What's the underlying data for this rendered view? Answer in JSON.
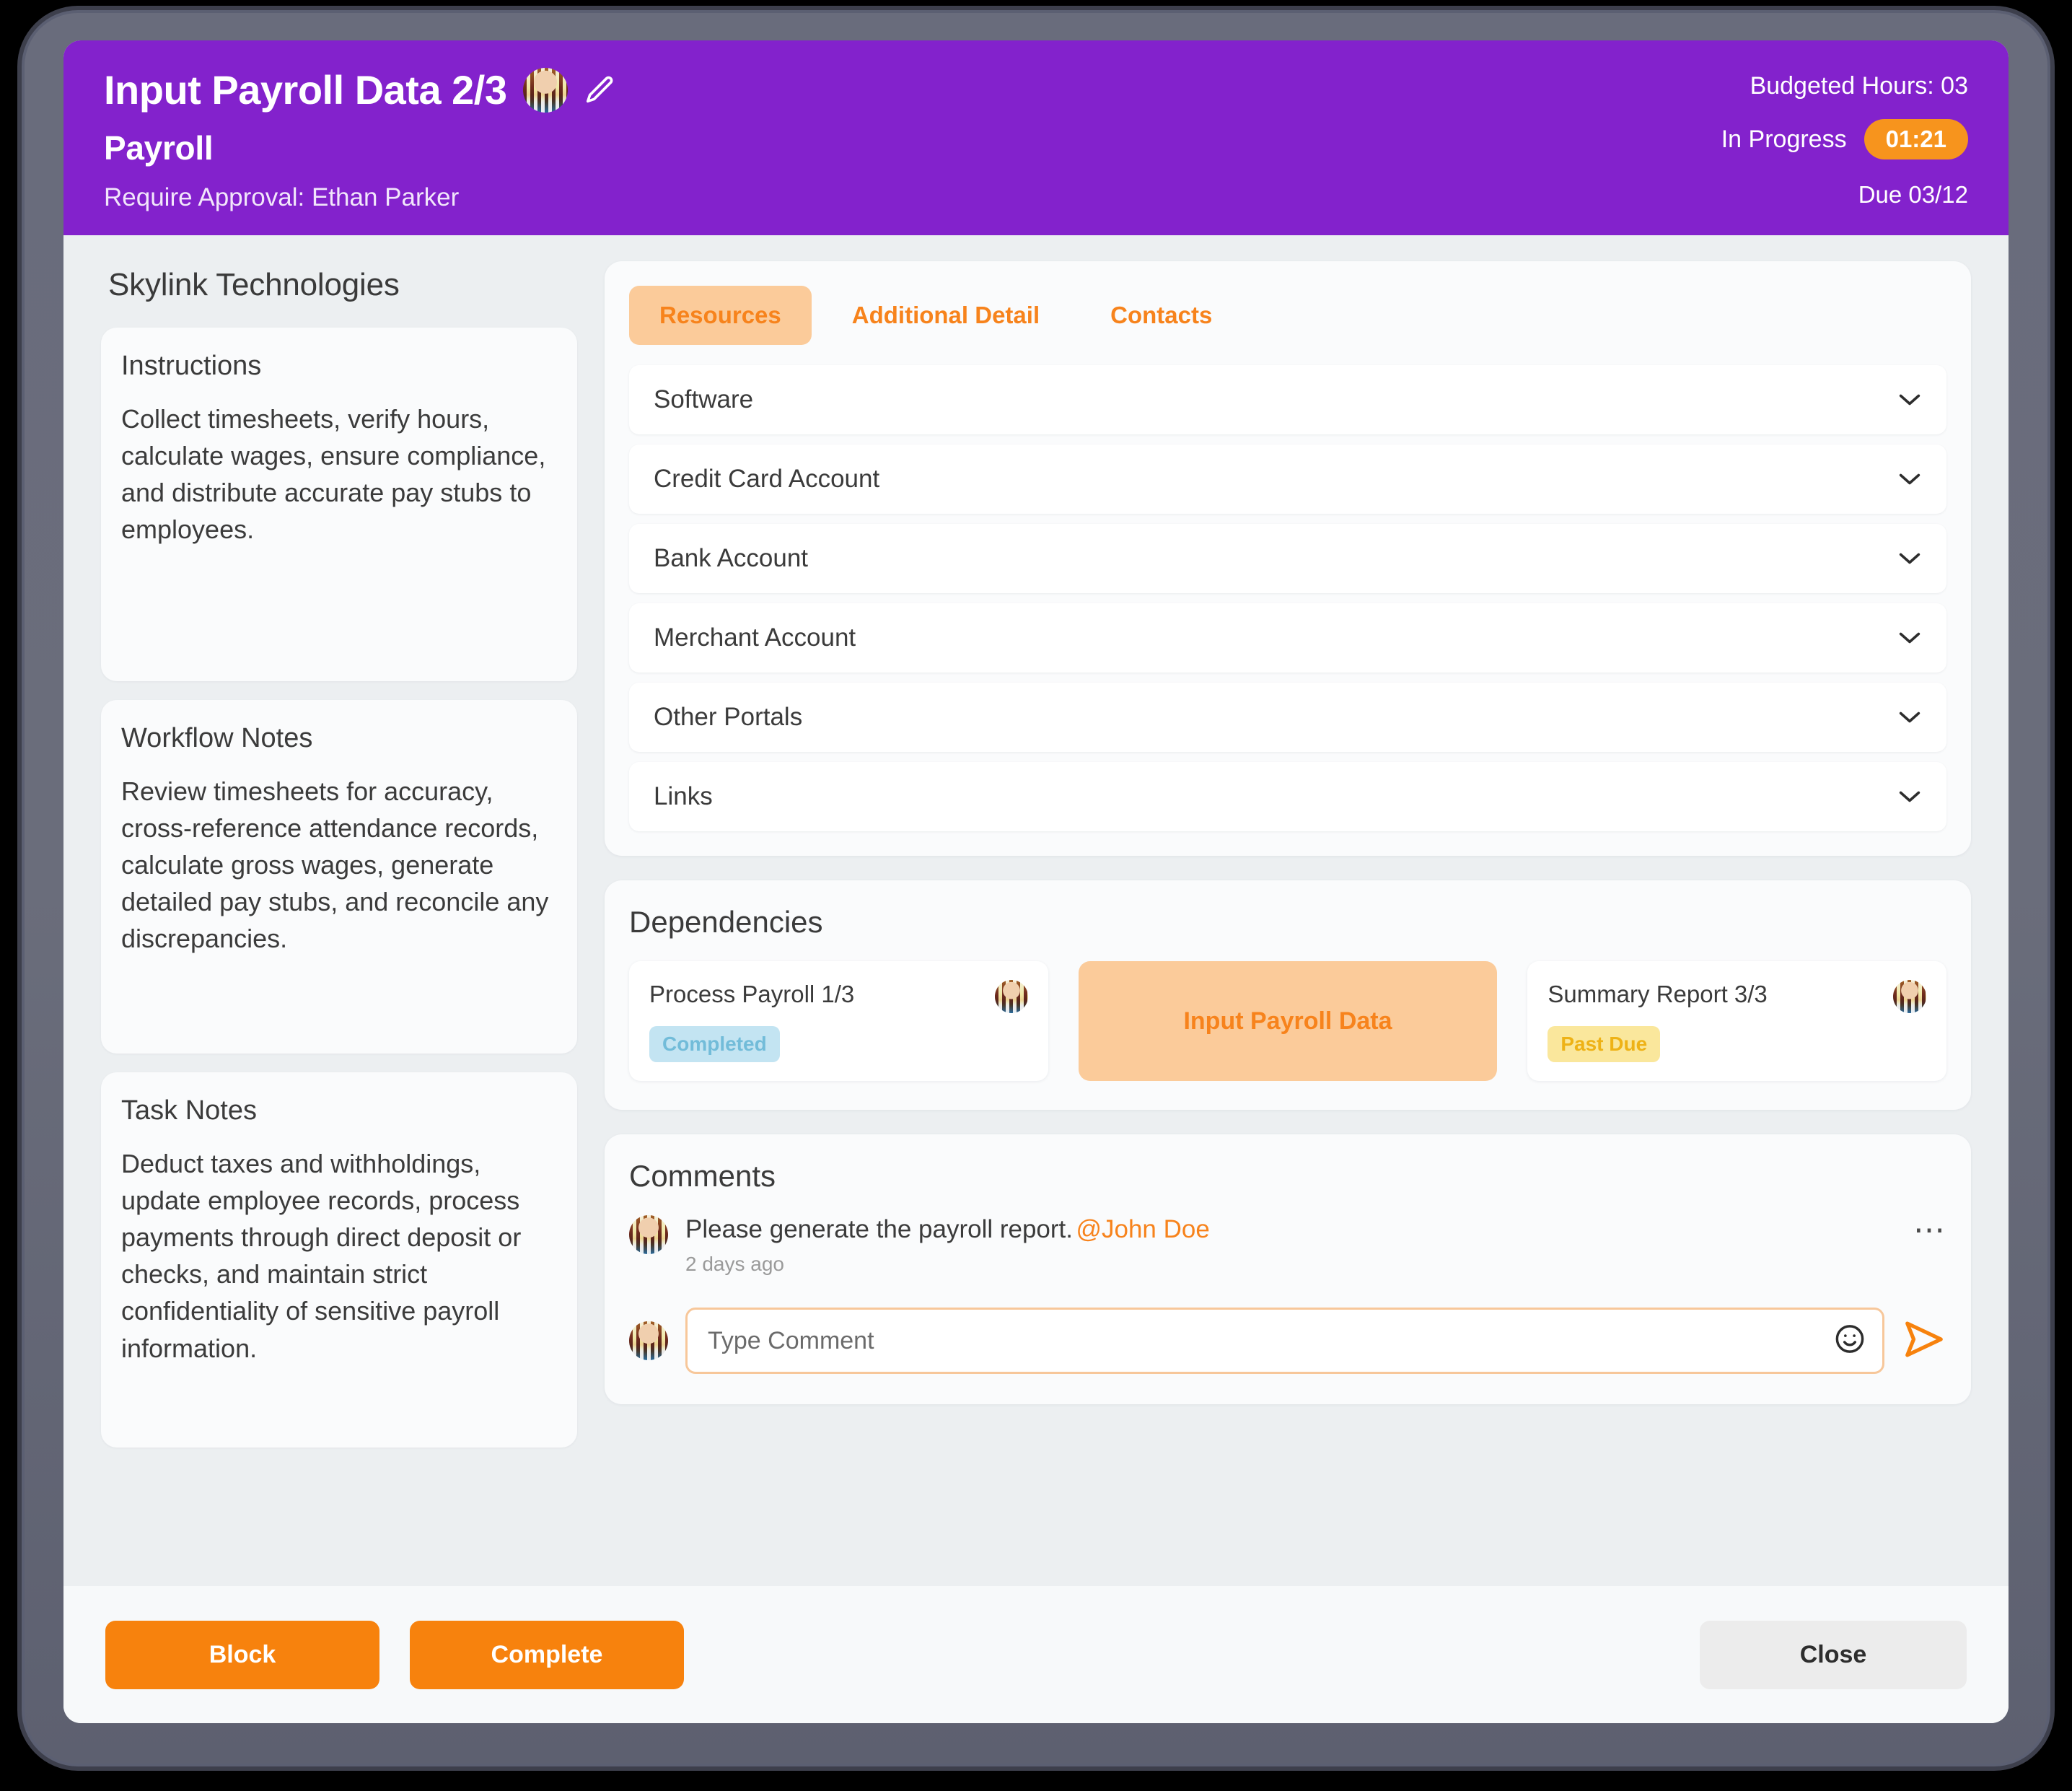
{
  "header": {
    "task_title": "Input Payroll Data 2/3",
    "assignee_avatar": "user-avatar",
    "edit_icon": "pencil-icon",
    "project_name": "Payroll",
    "approval_text": "Require Approval: Ethan Parker",
    "budgeted_hours": "Budgeted Hours: 03",
    "status": "In Progress",
    "timer": "01:21",
    "due": "Due 03/12",
    "bg_color": "#8322CC",
    "timer_color": "#F7941D"
  },
  "sidebar": {
    "company": "Skylink Technologies",
    "cards": [
      {
        "title": "Instructions",
        "text": "Collect timesheets, verify hours, calculate wages, ensure compliance, and distribute accurate pay stubs to employees."
      },
      {
        "title": "Workflow Notes",
        "text": "Review timesheets for accuracy, cross-reference attendance records, calculate gross wages, generate detailed pay stubs, and reconcile any discrepancies."
      },
      {
        "title": "Task Notes",
        "text": "Deduct taxes and withholdings, update employee records, process payments through direct deposit or checks, and maintain strict confidentiality of sensitive payroll information."
      }
    ]
  },
  "resources": {
    "tabs": [
      {
        "label": "Resources",
        "active": true
      },
      {
        "label": "Additional Detail",
        "active": false
      },
      {
        "label": "Contacts",
        "active": false
      }
    ],
    "accordion_icon": "chevron-down-icon",
    "items": [
      {
        "label": "Software"
      },
      {
        "label": "Credit Card Account"
      },
      {
        "label": "Bank Account"
      },
      {
        "label": "Merchant Account"
      },
      {
        "label": "Other Portals"
      },
      {
        "label": "Links"
      }
    ]
  },
  "dependencies": {
    "title": "Dependencies",
    "cards": [
      {
        "name": "Process Payroll 1/3",
        "badge": "Completed",
        "badge_type": "completed",
        "avatar": "user-avatar",
        "current": false
      },
      {
        "name": "Input Payroll Data",
        "badge": "",
        "badge_type": "",
        "avatar": "",
        "current": true
      },
      {
        "name": "Summary Report 3/3",
        "badge": "Past Due",
        "badge_type": "pastdue",
        "avatar": "user-avatar",
        "current": false
      }
    ]
  },
  "comments": {
    "title": "Comments",
    "items": [
      {
        "avatar": "user-avatar",
        "text": "Please generate the payroll report.",
        "mention": "@John Doe",
        "time": "2 days ago",
        "menu_icon": "more-options-icon"
      }
    ],
    "compose": {
      "avatar": "user-avatar",
      "placeholder": "Type Comment",
      "value": "",
      "emoji_icon": "smiley-icon",
      "send_icon": "send-icon"
    }
  },
  "footer": {
    "block_label": "Block",
    "complete_label": "Complete",
    "close_label": "Close",
    "primary_color": "#F7820D"
  }
}
